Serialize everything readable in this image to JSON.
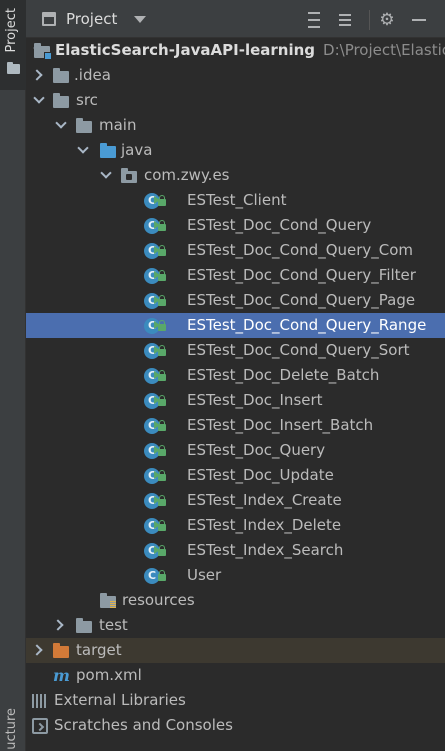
{
  "sidebar": {
    "project_tab_label": "Project",
    "structure_tab_label": "ucture"
  },
  "header": {
    "title": "Project",
    "icons": [
      "project-view-icon",
      "dropdown-caret-icon",
      "expand-all-icon",
      "collapse-all-icon",
      "gear-icon",
      "minimize-icon"
    ]
  },
  "tree": {
    "root": {
      "label": "ElasticSearch-JavaAPI-learning",
      "path": "D:\\Project\\ElasticSe"
    },
    "idea": "idea",
    "idea_prefix": ".",
    "src": "src",
    "main": "main",
    "java": "java",
    "package": "com.zwy.es",
    "classes": [
      "ESTest_Client",
      "ESTest_Doc_Cond_Query",
      "ESTest_Doc_Cond_Query_Com",
      "ESTest_Doc_Cond_Query_Filter",
      "ESTest_Doc_Cond_Query_Page",
      "ESTest_Doc_Cond_Query_Range",
      "ESTest_Doc_Cond_Query_Sort",
      "ESTest_Doc_Delete_Batch",
      "ESTest_Doc_Insert",
      "ESTest_Doc_Insert_Batch",
      "ESTest_Doc_Query",
      "ESTest_Doc_Update",
      "ESTest_Index_Create",
      "ESTest_Index_Delete",
      "ESTest_Index_Search",
      "User"
    ],
    "selected_class": "ESTest_Doc_Cond_Query_Range",
    "resources": "resources",
    "test": "test",
    "target": "target",
    "pom": "pom.xml",
    "pom_icon_letter": "m",
    "external_libraries": "External Libraries",
    "scratches": "Scratches and Consoles",
    "class_icon_letter": "C"
  },
  "colors": {
    "background": "#2b2b2b",
    "selection": "#4b6eaf",
    "folder_blue": "#4a9bd4",
    "folder_orange": "#d27a38",
    "run_green": "#59a869"
  }
}
